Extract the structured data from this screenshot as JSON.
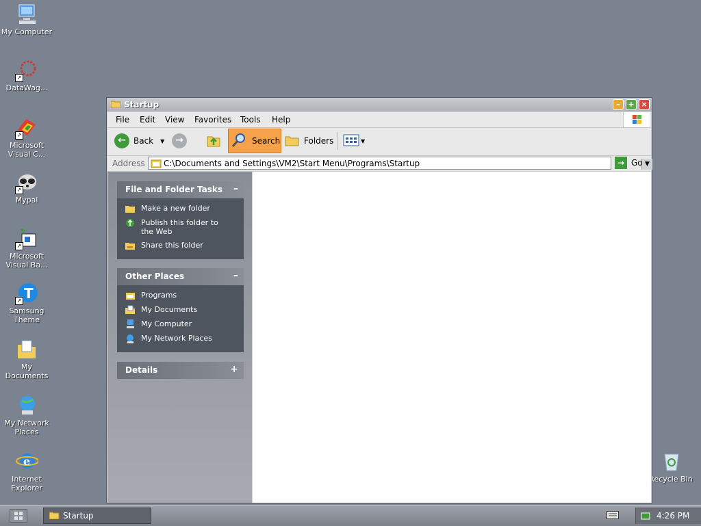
{
  "desktop": {
    "icons": [
      {
        "label": "My Computer"
      },
      {
        "label": "DataWag..."
      },
      {
        "label": "Microsoft Visual C..."
      },
      {
        "label": "Mypal"
      },
      {
        "label": "Microsoft Visual Ba..."
      },
      {
        "label": "Samsung Theme"
      },
      {
        "label": "My Documents"
      },
      {
        "label": "My Network Places"
      },
      {
        "label": "Internet Explorer"
      },
      {
        "label": "Recycle Bin"
      }
    ]
  },
  "window": {
    "title": "Startup",
    "menu": [
      "File",
      "Edit",
      "View",
      "Favorites",
      "Tools",
      "Help"
    ],
    "toolbar": {
      "back": "Back",
      "search": "Search",
      "folders": "Folders"
    },
    "address": {
      "label": "Address",
      "value": "C:\\Documents and Settings\\VM2\\Start Menu\\Programs\\Startup",
      "go": "Go"
    },
    "panels": {
      "file_folder_tasks": {
        "title": "File and Folder Tasks",
        "items": [
          "Make a new folder",
          "Publish this folder to the Web",
          "Share this folder"
        ]
      },
      "other_places": {
        "title": "Other Places",
        "items": [
          "Programs",
          "My Documents",
          "My Computer",
          "My Network Places"
        ]
      },
      "details": {
        "title": "Details"
      }
    }
  },
  "taskbar": {
    "task_label": "Startup",
    "clock": "4:26 PM"
  },
  "colors": {
    "desktop_bg": "#7b8290",
    "search_highlight": "#f5a24a",
    "panel_body": "#4e555e"
  }
}
